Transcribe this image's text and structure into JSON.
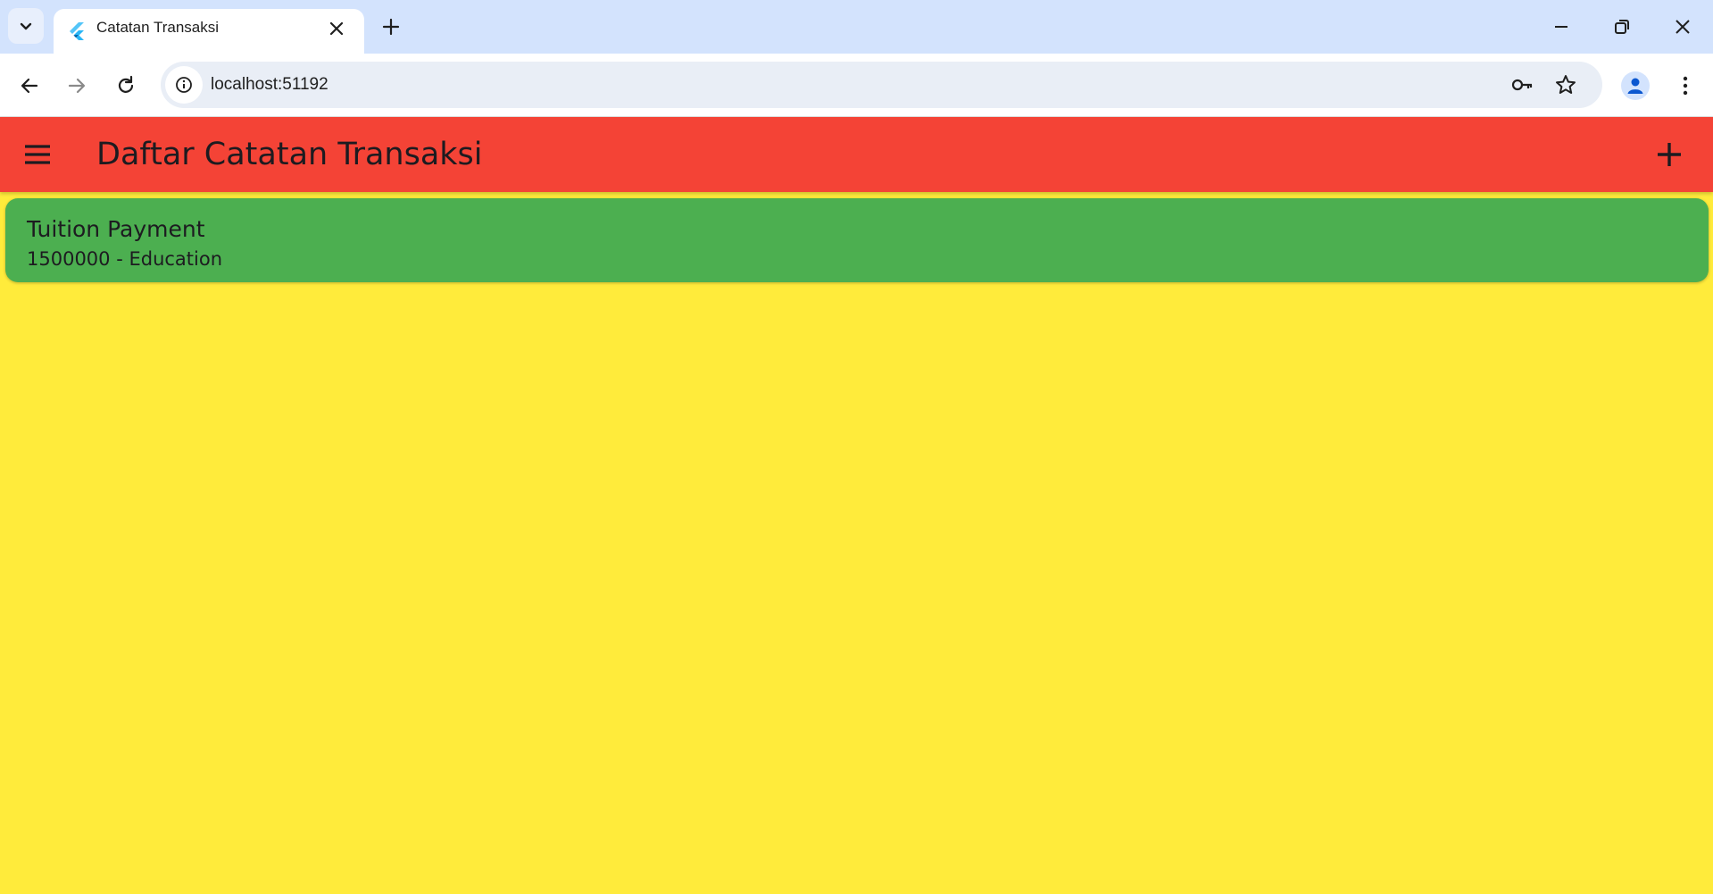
{
  "browser": {
    "tab": {
      "title": "Catatan Transaksi",
      "favicon": "flutter-logo-icon"
    },
    "address_bar": {
      "url": "localhost:51192"
    },
    "icons": {
      "tab_search": "chevron-down-icon",
      "tab_close": "close-icon",
      "new_tab": "plus-icon",
      "minimize": "minimize-icon",
      "restore": "restore-icon",
      "close_window": "close-icon",
      "back": "arrow-left-icon",
      "forward": "arrow-right-icon",
      "reload": "reload-icon",
      "site_info": "info-icon",
      "password": "key-icon",
      "bookmark": "star-icon",
      "profile": "person-icon",
      "menu": "more-vert-icon"
    }
  },
  "app": {
    "appbar": {
      "title": "Daftar Catatan Transaksi",
      "menu_icon": "hamburger-menu-icon",
      "add_icon": "plus-icon"
    },
    "transactions": [
      {
        "title": "Tuition Payment",
        "amount": "1500000",
        "separator": " - ",
        "category": "Education"
      }
    ]
  },
  "colors": {
    "appbar": "#f44336",
    "background": "#ffeb3b",
    "card": "#4caf50",
    "tabstrip": "#d3e3fd"
  }
}
